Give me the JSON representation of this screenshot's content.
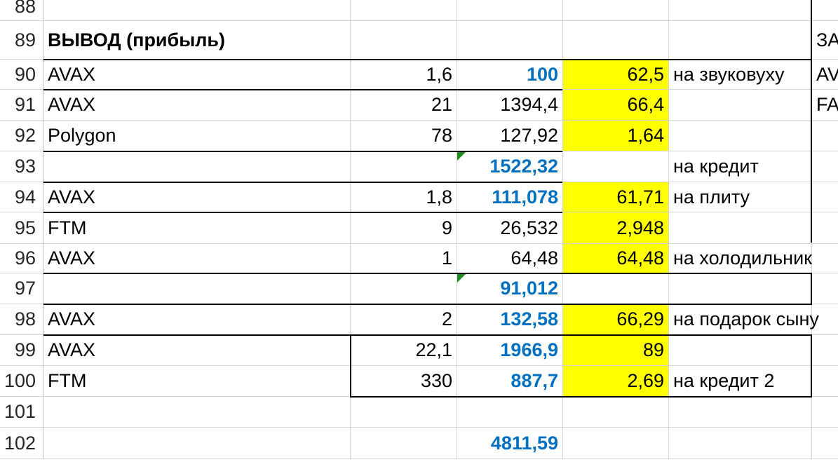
{
  "sheet": {
    "rows": [
      {
        "num": "88",
        "a": "",
        "b": "",
        "c": "",
        "d": "",
        "e": "",
        "f": ""
      },
      {
        "num": "89",
        "a": "ВЫВОД (прибыль)",
        "b": "",
        "c": "",
        "d": "",
        "e": "",
        "f": "ЗА"
      },
      {
        "num": "90",
        "a": "AVAX",
        "b": "1,6",
        "c": "100",
        "d": "62,5",
        "e": "на звуковуху",
        "f": "AV"
      },
      {
        "num": "91",
        "a": "AVAX",
        "b": "21",
        "c": "1394,4",
        "d": "66,4",
        "e": "",
        "f": "FA"
      },
      {
        "num": "92",
        "a": "Polygon",
        "b": "78",
        "c": "127,92",
        "d": "1,64",
        "e": "",
        "f": ""
      },
      {
        "num": "93",
        "a": "",
        "b": "",
        "c": "1522,32",
        "d": "",
        "e": "на кредит",
        "f": ""
      },
      {
        "num": "94",
        "a": "AVAX",
        "b": "1,8",
        "c": "111,078",
        "d": "61,71",
        "e": "на плиту",
        "f": ""
      },
      {
        "num": "95",
        "a": "FTM",
        "b": "9",
        "c": "26,532",
        "d": "2,948",
        "e": "",
        "f": ""
      },
      {
        "num": "96",
        "a": "AVAX",
        "b": "1",
        "c": "64,48",
        "d": "64,48",
        "e": "на холодильник",
        "f": ""
      },
      {
        "num": "97",
        "a": "",
        "b": "",
        "c": "91,012",
        "d": "",
        "e": "",
        "f": ""
      },
      {
        "num": "98",
        "a": "AVAX",
        "b": "2",
        "c": "132,58",
        "d": "66,29",
        "e": "на подарок сыну",
        "f": ""
      },
      {
        "num": "99",
        "a": "AVAX",
        "b": "22,1",
        "c": "1966,9",
        "d": "89",
        "e": "",
        "f": ""
      },
      {
        "num": "100",
        "a": "FTM",
        "b": "330",
        "c": "887,7",
        "d": "2,69",
        "e": "на кредит 2",
        "f": ""
      },
      {
        "num": "101",
        "a": "",
        "b": "",
        "c": "",
        "d": "",
        "e": "",
        "f": ""
      },
      {
        "num": "102",
        "a": "",
        "b": "",
        "c": "4811,59",
        "d": "",
        "e": "",
        "f": ""
      }
    ]
  },
  "colors": {
    "highlight": "#ffff00",
    "blue_text": "#0070c0",
    "comment_marker": "#1e8c1e",
    "grid": "#d4d4d4"
  }
}
